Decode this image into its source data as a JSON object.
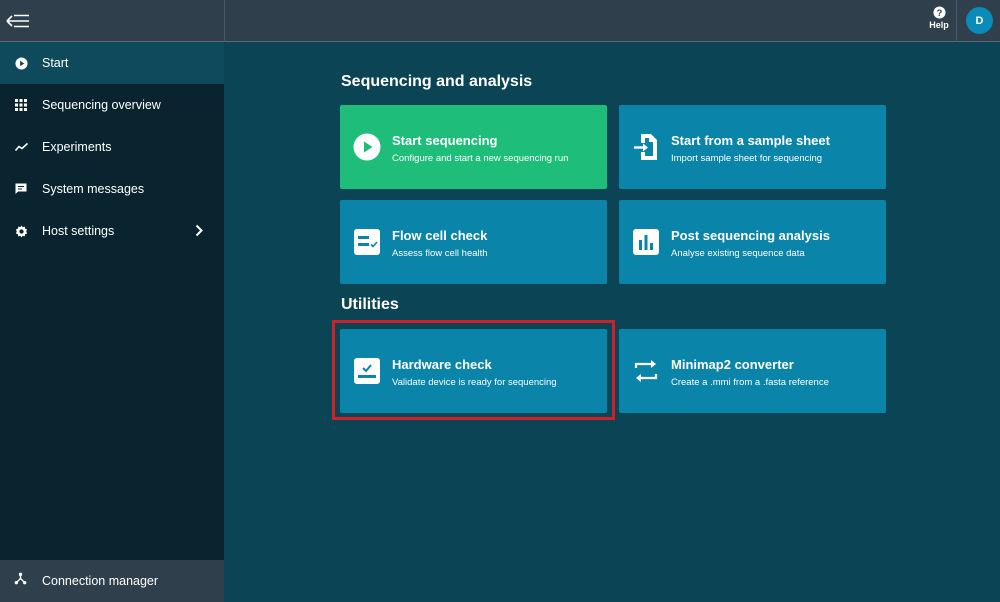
{
  "topbar": {
    "help_label": "Help",
    "avatar_initial": "D"
  },
  "sidebar": {
    "items": [
      {
        "label": "Start",
        "icon": "play-circle-icon",
        "active": true
      },
      {
        "label": "Sequencing overview",
        "icon": "grid-icon"
      },
      {
        "label": "Experiments",
        "icon": "trend-line-icon"
      },
      {
        "label": "System messages",
        "icon": "message-icon"
      },
      {
        "label": "Host settings",
        "icon": "gear-icon"
      }
    ],
    "connection_manager": "Connection manager"
  },
  "main": {
    "section_sequencing": "Sequencing and analysis",
    "section_utilities": "Utilities",
    "cards": [
      {
        "title": "Start sequencing",
        "subtitle": "Configure and start a new sequencing run"
      },
      {
        "title": "Start from a sample sheet",
        "subtitle": "Import sample sheet for sequencing"
      },
      {
        "title": "Flow cell check",
        "subtitle": "Assess flow cell health"
      },
      {
        "title": "Post sequencing analysis",
        "subtitle": "Analyse existing sequence data"
      },
      {
        "title": "Hardware check",
        "subtitle": "Validate device is ready for sequencing"
      },
      {
        "title": "Minimap2 converter",
        "subtitle": "Create a .mmi from a .fasta reference"
      }
    ]
  },
  "colors": {
    "accent_card": "#0a84a8",
    "primary_card": "#1ebd7a",
    "highlight": "#d0202a"
  }
}
